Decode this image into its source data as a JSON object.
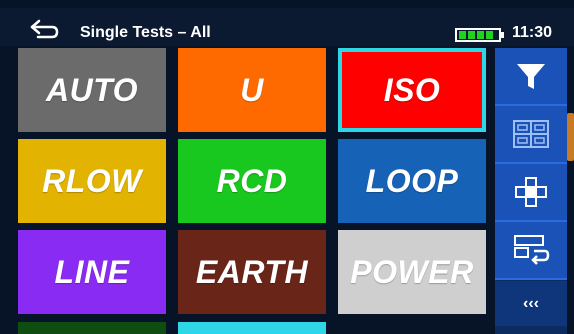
{
  "header": {
    "title": "Single Tests – All",
    "time": "11:30",
    "battery_level": 1.0,
    "back_icon": "back-arrow-icon",
    "battery_icon": "battery-icon"
  },
  "tiles": [
    {
      "label": "AUTO",
      "color": "#6b6b6b",
      "selected": false
    },
    {
      "label": "U",
      "color": "#ff6a00",
      "selected": false
    },
    {
      "label": "ISO",
      "color": "#ff0000",
      "selected": true
    },
    {
      "label": "RLOW",
      "color": "#e2b300",
      "selected": false
    },
    {
      "label": "RCD",
      "color": "#19c81e",
      "selected": false
    },
    {
      "label": "LOOP",
      "color": "#1662b6",
      "selected": false
    },
    {
      "label": "LINE",
      "color": "#8a2bf3",
      "selected": false
    },
    {
      "label": "EARTH",
      "color": "#6a2519",
      "selected": false
    },
    {
      "label": "POWER",
      "color": "#cfcfcf",
      "selected": false
    }
  ],
  "partial_tiles": [
    {
      "color": "#0d4d10"
    },
    {
      "color": "#2fd7e6"
    }
  ],
  "sidebar": {
    "buttons": [
      {
        "icon": "filter-icon"
      },
      {
        "icon": "grid-view-icon"
      },
      {
        "icon": "cross-layout-icon"
      },
      {
        "icon": "list-return-icon"
      }
    ],
    "more_label": "‹‹‹"
  },
  "colors": {
    "selection_border": "#2fd7e6",
    "sidebar_button": "#1b52b7",
    "background": "#071427",
    "scroll_indicator": "#c87a25"
  }
}
